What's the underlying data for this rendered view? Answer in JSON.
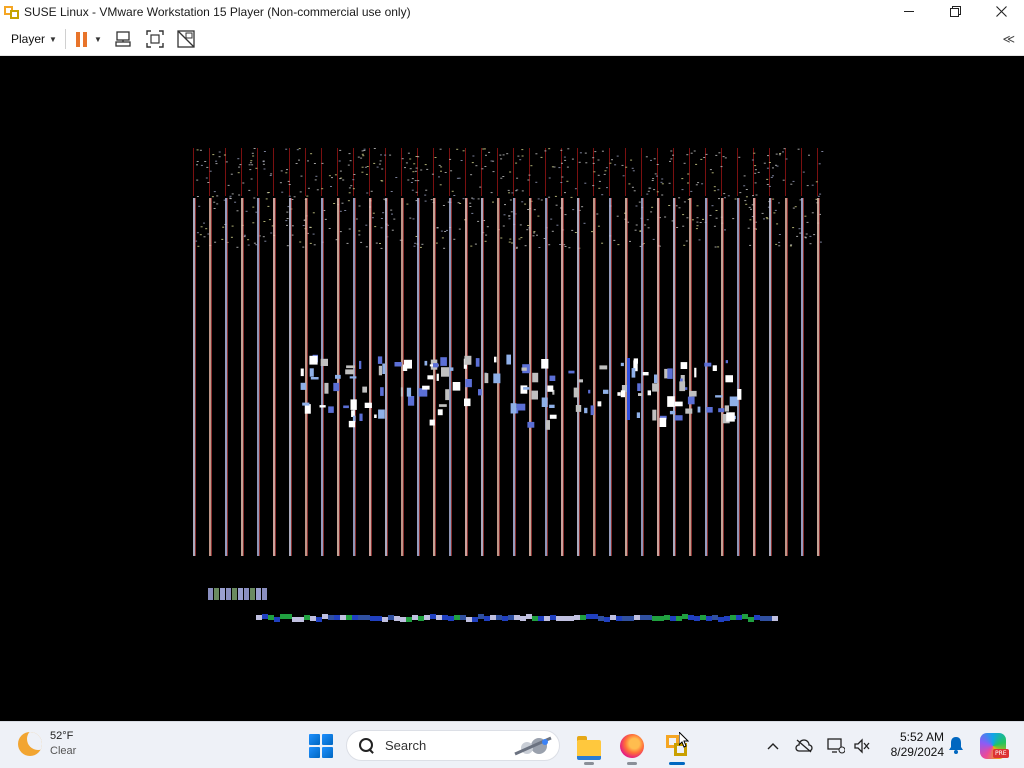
{
  "window": {
    "title": "SUSE Linux - VMware Workstation 15 Player (Non-commercial use only)",
    "controls": [
      "minimize",
      "restore",
      "close"
    ]
  },
  "toolbar": {
    "player_label": "Player",
    "icons": [
      "pause-icon",
      "send-ctrl-alt-del-icon",
      "fullscreen-icon",
      "unity-icon"
    ]
  },
  "vm": {
    "state": "Garbled graphical output on guest display"
  },
  "taskbar": {
    "weather": {
      "temp": "52°F",
      "condition": "Clear"
    },
    "search_label": "Search",
    "apps": [
      "file-explorer",
      "firefox",
      "vmware-player"
    ],
    "clock": {
      "time": "5:52 AM",
      "date": "8/29/2024"
    },
    "copilot_badge": "PRE"
  },
  "colors": {
    "titlebar": "#ffffff",
    "pause_accent": "#e8742a",
    "vm_background": "#000000",
    "taskbar": "#eef1f7",
    "active_indicator": "#0067c0"
  }
}
